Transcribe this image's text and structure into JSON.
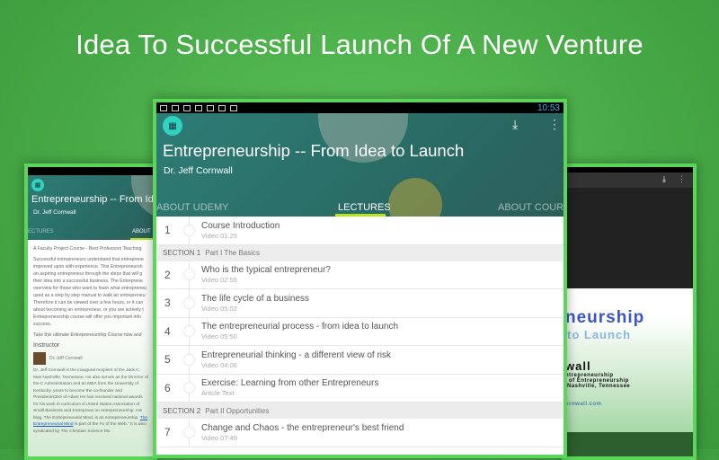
{
  "headline": "Idea To Successful Launch Of A New Venture",
  "status": {
    "time": "10:53"
  },
  "course": {
    "title": "Entrepreneurship -- From Idea to Launch",
    "author": "Dr. Jeff Cornwall"
  },
  "tabs": {
    "about_udemy": "ABOUT UDEMY",
    "lectures": "LECTURES",
    "about_course": "ABOUT COURSE"
  },
  "lectures": [
    {
      "type": "lecture",
      "num": "1",
      "title": "Course Introduction",
      "meta": "Video 01:25"
    },
    {
      "type": "section",
      "label": "SECTION 1",
      "title": "Part I The Basics"
    },
    {
      "type": "lecture",
      "num": "2",
      "title": "Who is the typical entrepreneur?",
      "meta": "Video 02:55"
    },
    {
      "type": "lecture",
      "num": "3",
      "title": "The life cycle of a business",
      "meta": "Video 05:02"
    },
    {
      "type": "lecture",
      "num": "4",
      "title": "The entrepreneurial process - from idea to launch",
      "meta": "Video 05:50"
    },
    {
      "type": "lecture",
      "num": "5",
      "title": "Entrepreneurial thinking - a different view of risk",
      "meta": "Video 04:06"
    },
    {
      "type": "lecture",
      "num": "6",
      "title": "Exercise:  Learning from other Entrepreneurs",
      "meta": "Article Text"
    },
    {
      "type": "section",
      "label": "SECTION 2",
      "title": "Part II Opportunities"
    },
    {
      "type": "lecture",
      "num": "7",
      "title": "Change and Chaos - the entrepreneur's best friend",
      "meta": "Video 07:49"
    }
  ],
  "left": {
    "title": "Entrepreneurship -- From Idea",
    "tab1": "ECTURES",
    "tab2": "ABOUT",
    "tagline": "A Faculty Project Course - Best Professors Teaching",
    "para1": "Successful entrepreneurs understand that entreprene improved upon with experience.  This Entrepreneursh an aspiring entrepreneur through the steps that will g their idea into a successful business.  The Entreprene overview for those who want to learn what entrepreneu used as a step by step manual to walk an entrepreneu Therefore it can be viewed over a few hours, or it can about becoming an entrepreneur, or you are actively t Entrepreneurship course will offer you important info success.",
    "para2": "Take this ultimate Entrepreneurship Course now and",
    "instructor_heading": "Instructor",
    "instructor_name": "Dr. Jeff Cornwall",
    "bio": "Dr. Jeff Cornwall is the inaugural recipient of the Jack C. Mas Nashville, Tennessee.  He also serves as the Director of the C Administration and an MBA from the University of Kentucky. years to become the co-founder and President/CEO of Atlant He has received national awards for his work in curriculum d United States Association of Small Business and Entreprene on entrepreneurship.  His blog, The Entrepreneurial Mind, is an entrepreneurship.",
    "link": "The Entrepreneurial Mind",
    "bio_end": "is part of the Fo of the Web.\" It is also syndicated by The Christian Science Mo"
  },
  "right": {
    "line1": "neurship",
    "line2": "to Launch",
    "name": "wall",
    "l3": "ntrepreneurship",
    "l4": "of Entrepreneurship",
    "l5": "Nashville, Tennessee",
    "url": "ornwall.com"
  },
  "colors": {
    "accent": "#b5e61d",
    "bg": "#4aad4a",
    "frame": "#5bd65b"
  }
}
